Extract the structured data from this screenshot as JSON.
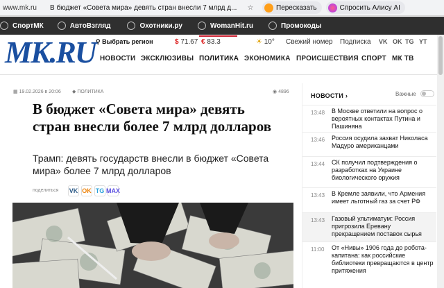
{
  "browser": {
    "url": "www.mk.ru",
    "tab_title": "В бюджет «Совета мира» девять стран внесли 7 млрд д...",
    "bookmark_icon": "star-icon",
    "retell_label": "Пересказать",
    "ask_alice_label": "Спросить Алису AI"
  },
  "partners": [
    {
      "label": "СпортМК",
      "icon": "sport-icon"
    },
    {
      "label": "АвтоВзгляд",
      "icon": "car-icon"
    },
    {
      "label": "Охотники.ру",
      "icon": "hunt-icon"
    },
    {
      "label": "WomanHit.ru",
      "icon": "woman-icon"
    },
    {
      "label": "Промокоды",
      "icon": "promo-icon"
    }
  ],
  "header": {
    "logo": "MK.RU",
    "region": "Выбрать регион",
    "usd": "71.67",
    "eur": "83.3",
    "weather": "10°",
    "fresh_issue": "Свежий номер",
    "subscribe": "Подписка",
    "nav": [
      "НОВОСТИ",
      "ЭКСКЛЮЗИВЫ",
      "ПОЛИТИКА",
      "ЭКОНОМИКА",
      "ПРОИСШЕСТВИЯ",
      "СПОРТ",
      "МК ТВ"
    ],
    "active_nav": "ПОЛИТИКА",
    "social": [
      "VK",
      "OK",
      "TG",
      "YT"
    ]
  },
  "article": {
    "date": "19.02.2026 в 20:06",
    "category": "ПОЛИТИКА",
    "views": "4896",
    "title": "В бюджет «Совета мира» девять стран внесли более 7 млрд долларов",
    "lead": "Трамп: девять государств внесли в бюджет «Совета мира» более 7 млрд долларов",
    "share_label": "поделиться",
    "share_buttons": [
      "VK",
      "OK",
      "TG",
      "MAX"
    ]
  },
  "sidebar": {
    "title": "НОВОСТИ",
    "important_label": "Важные",
    "items": [
      {
        "time": "13:48",
        "text": "В Москве ответили на вопрос о вероятных контактах Путина и Пашиняна"
      },
      {
        "time": "13:46",
        "text": "Россия осудила захват Николаса Мадуро американцами"
      },
      {
        "time": "13:44",
        "text": "СК получил подтверждения о разработках на Украине биологического оружия"
      },
      {
        "time": "13:43",
        "text": "В Кремле заявили, что Армения имеет льготный газ за счет РФ"
      },
      {
        "time": "13:43",
        "text": "Газовый ультиматум: Россия пригрозила Еревану прекращением поставок сырья"
      },
      {
        "time": "11:00",
        "text": "От «Нивы» 1906 года до робота-капитана: как российские библиотеки превращаются в центр притяжения"
      }
    ]
  },
  "colors": {
    "brand": "#1a4fa0",
    "accent": "#c91f2f"
  }
}
